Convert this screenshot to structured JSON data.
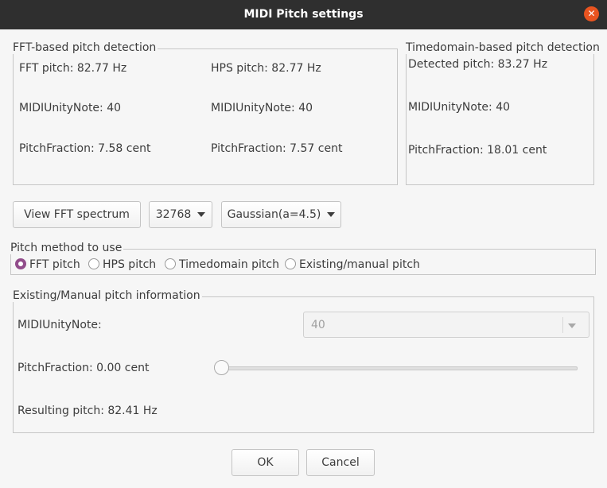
{
  "window": {
    "title": "MIDI Pitch settings",
    "close_symbol": "✕"
  },
  "fft_group": {
    "title": "FFT-based pitch detection",
    "fft_pitch": "FFT pitch: 82.77 Hz",
    "fft_midi_note": "MIDIUnityNote: 40",
    "fft_pitch_fraction": "PitchFraction: 7.58 cent",
    "hps_pitch": "HPS pitch: 82.77 Hz",
    "hps_midi_note": "MIDIUnityNote: 40",
    "hps_pitch_fraction": "PitchFraction: 7.57 cent"
  },
  "time_group": {
    "title": "Timedomain-based pitch detection",
    "detected_pitch": "Detected pitch: 83.27 Hz",
    "midi_note": "MIDIUnityNote: 40",
    "pitch_fraction": "PitchFraction: 18.01 cent"
  },
  "controls": {
    "view_fft_button": "View FFT spectrum",
    "fft_size": "32768",
    "window_function": "Gaussian(a=4.5)"
  },
  "method_group": {
    "title": "Pitch method to use",
    "options": [
      {
        "label": "FFT pitch",
        "selected": true
      },
      {
        "label": "HPS pitch",
        "selected": false
      },
      {
        "label": "Timedomain pitch",
        "selected": false
      },
      {
        "label": "Existing/manual pitch",
        "selected": false
      }
    ]
  },
  "manual_group": {
    "title": "Existing/Manual pitch information",
    "midi_note_label": "MIDIUnityNote:",
    "midi_note_value": "40",
    "pitch_fraction_label": "PitchFraction: 0.00 cent",
    "pitch_fraction_slider_fraction": 0,
    "resulting_pitch": "Resulting pitch: 82.41 Hz"
  },
  "buttons": {
    "ok": "OK",
    "cancel": "Cancel"
  },
  "colors": {
    "titlebar": "#2f2f2f",
    "close": "#e95420",
    "radio_selected": "#924d8b",
    "background": "#f6f6f6"
  }
}
